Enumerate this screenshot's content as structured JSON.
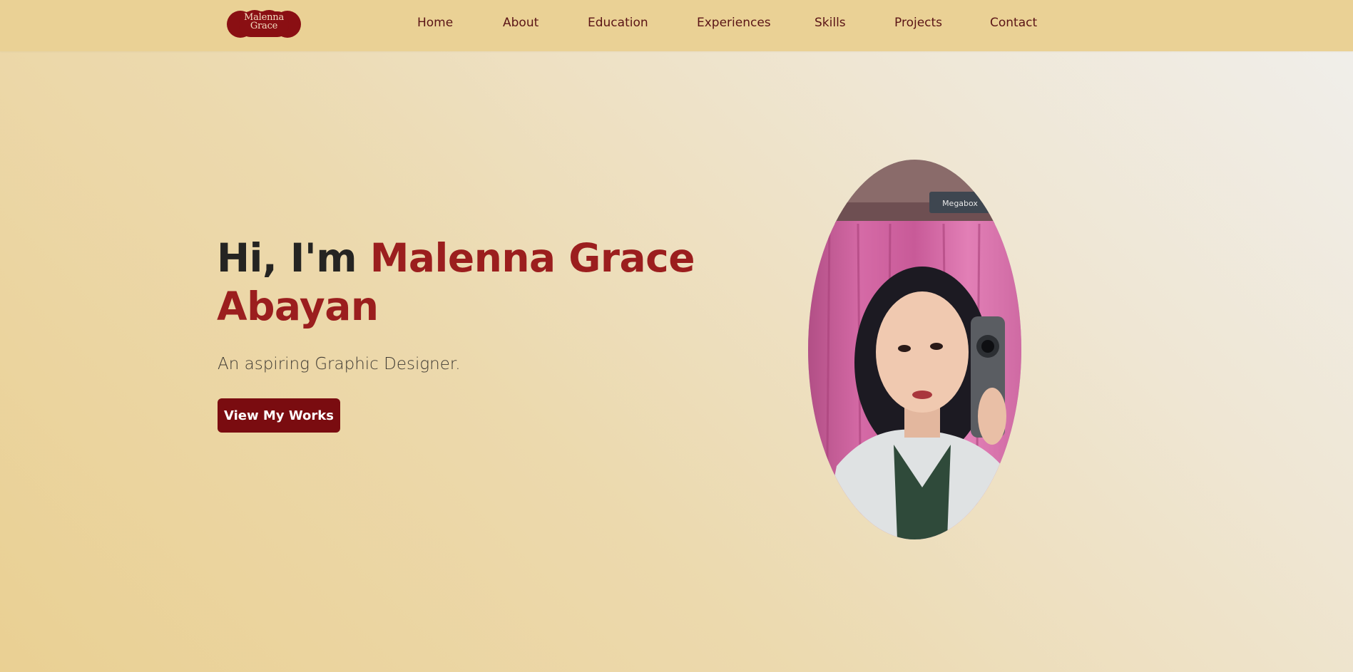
{
  "brand": {
    "logo_line1": "Malenna",
    "logo_line2": "Grace",
    "logo_color": "#8a0f13"
  },
  "nav": {
    "items": [
      "Home",
      "About",
      "Education",
      "Experiences",
      "Skills",
      "Projects",
      "Contact"
    ]
  },
  "hero": {
    "greeting": "Hi, I'm ",
    "name_line1": "Malenna Grace",
    "name_line2": "Abayan",
    "subtitle": "An aspiring Graphic Designer.",
    "cta_label": "View My Works",
    "portrait_sign": "Megabox"
  },
  "colors": {
    "accent": "#9b1e1e",
    "button": "#7a0c10",
    "navbar": "#ead195",
    "nav_text": "#5a1416"
  }
}
